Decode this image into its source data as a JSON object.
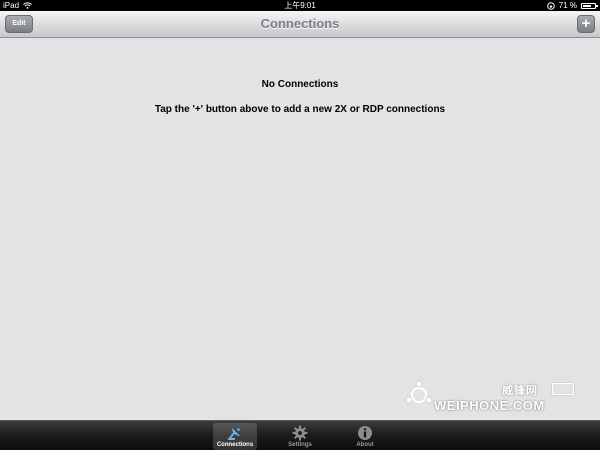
{
  "status_bar": {
    "device": "iPad",
    "time": "上午9:01",
    "battery_text": "71 %",
    "battery_level": 0.71
  },
  "nav": {
    "title": "Connections",
    "edit_label": "Edit",
    "add_label": "+"
  },
  "content": {
    "empty_title": "No Connections",
    "empty_hint": "Tap the '+' button above to add a new 2X or RDP connections"
  },
  "watermark": {
    "chinese": "威锋网",
    "english": "WEIPHONE.COM"
  },
  "tabs": [
    {
      "label": "Connections",
      "icon": "connections-icon",
      "active": true
    },
    {
      "label": "Settings",
      "icon": "gear-icon",
      "active": false
    },
    {
      "label": "About",
      "icon": "info-icon",
      "active": false
    }
  ],
  "colors": {
    "background": "#e3e3e5",
    "nav_title": "#7a7d82",
    "tab_bar": "#1b1b1d"
  }
}
